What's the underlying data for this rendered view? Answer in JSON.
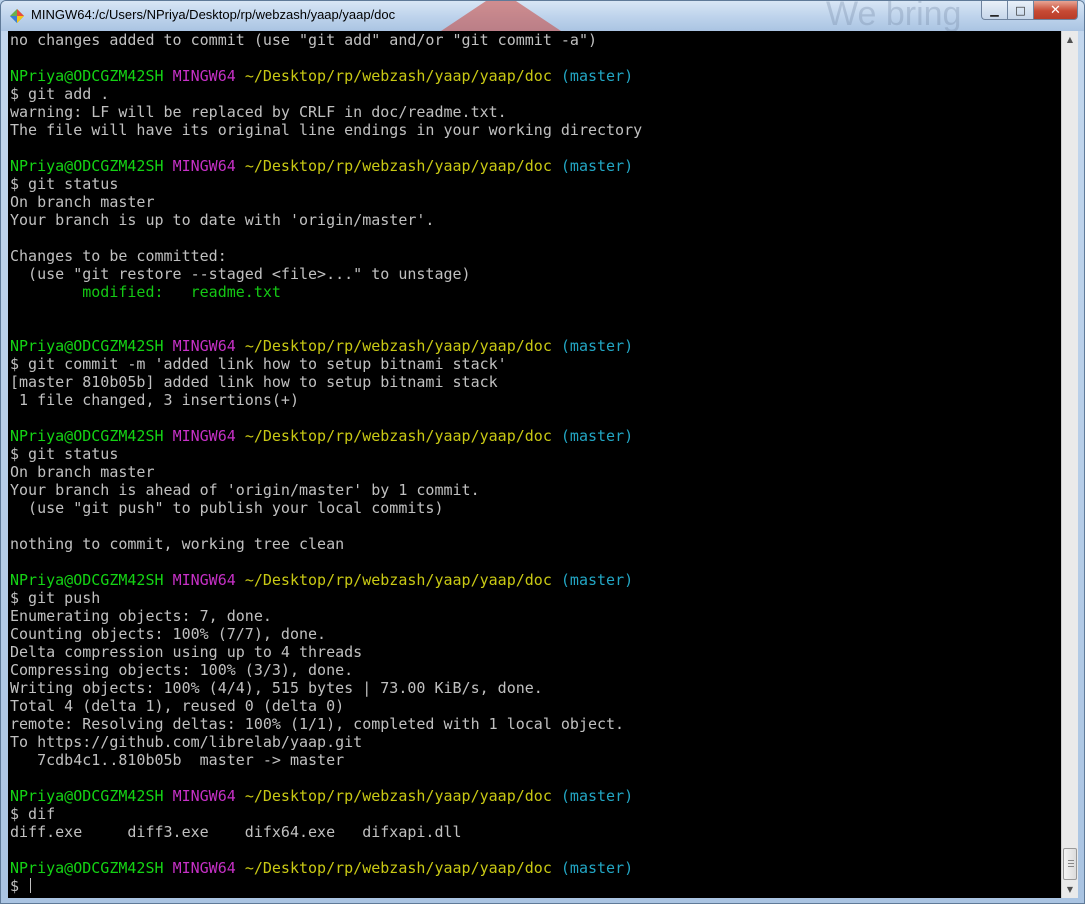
{
  "window": {
    "title": "MINGW64:/c/Users/NPriya/Desktop/rp/webzash/yaap/yaap/doc",
    "icon": "mingw-app-icon",
    "watermark_text": "We bring",
    "controls": {
      "minimize_icon": "minimize-icon",
      "maximize_icon": "maximize-icon",
      "close_icon": "close-icon"
    }
  },
  "colors": {
    "background": "#000000",
    "text": "#c0c0c0",
    "user": "#14d414",
    "host": "#c630c6",
    "path": "#c9c914",
    "branch": "#22a6c4",
    "modified": "#14c814"
  },
  "terminal": {
    "lines": [
      [
        {
          "t": "no changes added to commit (use \"git add\" and/or \"git commit -a\")",
          "c": "default"
        }
      ],
      [],
      [
        {
          "t": "NPriya@ODCGZM42SH ",
          "c": "user"
        },
        {
          "t": "MINGW64 ",
          "c": "host"
        },
        {
          "t": "~/Desktop/rp/webzash/yaap/yaap/doc ",
          "c": "path"
        },
        {
          "t": "(master)",
          "c": "branch"
        }
      ],
      [
        {
          "t": "$ git add .",
          "c": "default"
        }
      ],
      [
        {
          "t": "warning: LF will be replaced by CRLF in doc/readme.txt.",
          "c": "default"
        }
      ],
      [
        {
          "t": "The file will have its original line endings in your working directory",
          "c": "default"
        }
      ],
      [],
      [
        {
          "t": "NPriya@ODCGZM42SH ",
          "c": "user"
        },
        {
          "t": "MINGW64 ",
          "c": "host"
        },
        {
          "t": "~/Desktop/rp/webzash/yaap/yaap/doc ",
          "c": "path"
        },
        {
          "t": "(master)",
          "c": "branch"
        }
      ],
      [
        {
          "t": "$ git status",
          "c": "default"
        }
      ],
      [
        {
          "t": "On branch master",
          "c": "default"
        }
      ],
      [
        {
          "t": "Your branch is up to date with 'origin/master'.",
          "c": "default"
        }
      ],
      [],
      [
        {
          "t": "Changes to be committed:",
          "c": "default"
        }
      ],
      [
        {
          "t": "  (use \"git restore --staged <file>...\" to unstage)",
          "c": "default"
        }
      ],
      [
        {
          "t": "        modified:   readme.txt",
          "c": "green"
        }
      ],
      [],
      [],
      [
        {
          "t": "NPriya@ODCGZM42SH ",
          "c": "user"
        },
        {
          "t": "MINGW64 ",
          "c": "host"
        },
        {
          "t": "~/Desktop/rp/webzash/yaap/yaap/doc ",
          "c": "path"
        },
        {
          "t": "(master)",
          "c": "branch"
        }
      ],
      [
        {
          "t": "$ git commit -m 'added link how to setup bitnami stack'",
          "c": "default"
        }
      ],
      [
        {
          "t": "[master 810b05b] added link how to setup bitnami stack",
          "c": "default"
        }
      ],
      [
        {
          "t": " 1 file changed, 3 insertions(+)",
          "c": "default"
        }
      ],
      [],
      [
        {
          "t": "NPriya@ODCGZM42SH ",
          "c": "user"
        },
        {
          "t": "MINGW64 ",
          "c": "host"
        },
        {
          "t": "~/Desktop/rp/webzash/yaap/yaap/doc ",
          "c": "path"
        },
        {
          "t": "(master)",
          "c": "branch"
        }
      ],
      [
        {
          "t": "$ git status",
          "c": "default"
        }
      ],
      [
        {
          "t": "On branch master",
          "c": "default"
        }
      ],
      [
        {
          "t": "Your branch is ahead of 'origin/master' by 1 commit.",
          "c": "default"
        }
      ],
      [
        {
          "t": "  (use \"git push\" to publish your local commits)",
          "c": "default"
        }
      ],
      [],
      [
        {
          "t": "nothing to commit, working tree clean",
          "c": "default"
        }
      ],
      [],
      [
        {
          "t": "NPriya@ODCGZM42SH ",
          "c": "user"
        },
        {
          "t": "MINGW64 ",
          "c": "host"
        },
        {
          "t": "~/Desktop/rp/webzash/yaap/yaap/doc ",
          "c": "path"
        },
        {
          "t": "(master)",
          "c": "branch"
        }
      ],
      [
        {
          "t": "$ git push",
          "c": "default"
        }
      ],
      [
        {
          "t": "Enumerating objects: 7, done.",
          "c": "default"
        }
      ],
      [
        {
          "t": "Counting objects: 100% (7/7), done.",
          "c": "default"
        }
      ],
      [
        {
          "t": "Delta compression using up to 4 threads",
          "c": "default"
        }
      ],
      [
        {
          "t": "Compressing objects: 100% (3/3), done.",
          "c": "default"
        }
      ],
      [
        {
          "t": "Writing objects: 100% (4/4), 515 bytes | 73.00 KiB/s, done.",
          "c": "default"
        }
      ],
      [
        {
          "t": "Total 4 (delta 1), reused 0 (delta 0)",
          "c": "default"
        }
      ],
      [
        {
          "t": "remote: Resolving deltas: 100% (1/1), completed with 1 local object.",
          "c": "default"
        }
      ],
      [
        {
          "t": "To https://github.com/librelab/yaap.git",
          "c": "default"
        }
      ],
      [
        {
          "t": "   7cdb4c1..810b05b  master -> master",
          "c": "default"
        }
      ],
      [],
      [
        {
          "t": "NPriya@ODCGZM42SH ",
          "c": "user"
        },
        {
          "t": "MINGW64 ",
          "c": "host"
        },
        {
          "t": "~/Desktop/rp/webzash/yaap/yaap/doc ",
          "c": "path"
        },
        {
          "t": "(master)",
          "c": "branch"
        }
      ],
      [
        {
          "t": "$ dif",
          "c": "default"
        }
      ],
      [
        {
          "t": "diff.exe     diff3.exe    difx64.exe   difxapi.dll",
          "c": "default"
        }
      ],
      [],
      [
        {
          "t": "NPriya@ODCGZM42SH ",
          "c": "user"
        },
        {
          "t": "MINGW64 ",
          "c": "host"
        },
        {
          "t": "~/Desktop/rp/webzash/yaap/yaap/doc ",
          "c": "path"
        },
        {
          "t": "(master)",
          "c": "branch"
        }
      ]
    ],
    "input_prompt": "$ "
  },
  "scrollbar": {
    "up_icon": "scroll-up-arrow-icon",
    "down_icon": "scroll-down-arrow-icon"
  }
}
